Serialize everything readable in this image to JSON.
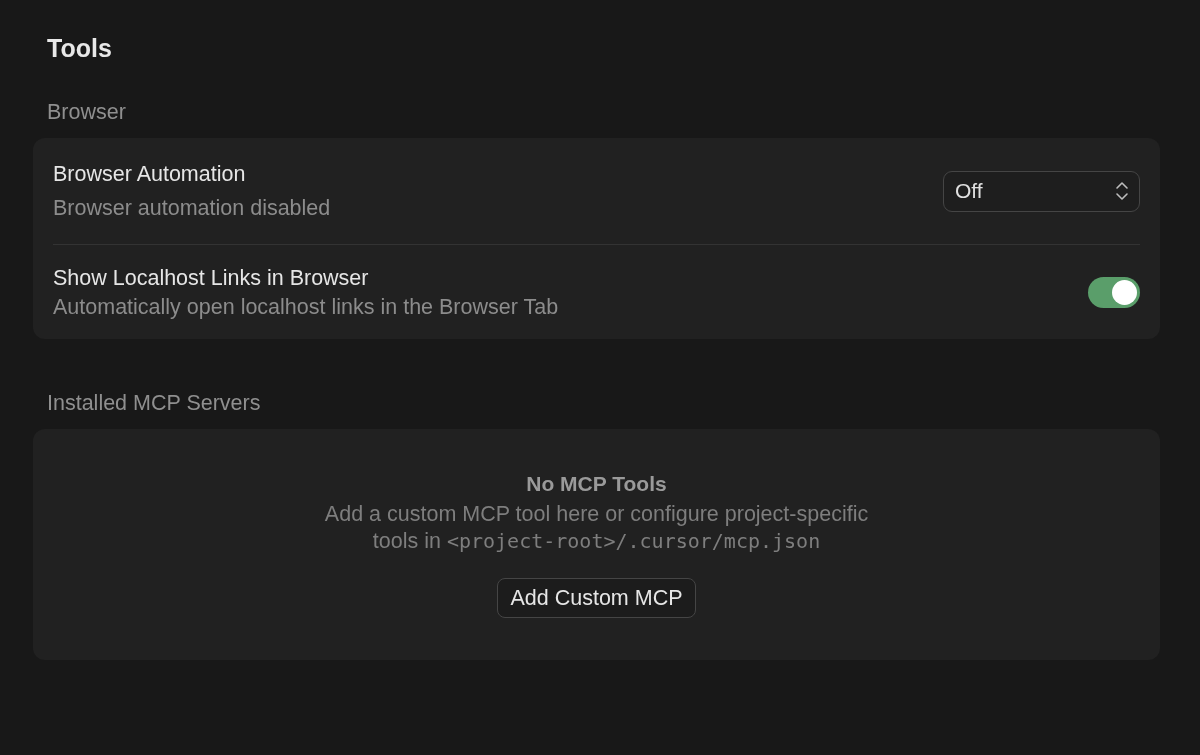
{
  "page": {
    "title": "Tools"
  },
  "sections": [
    {
      "label": "Browser",
      "kind": "settings",
      "settings": [
        {
          "kind": "select",
          "title": "Browser Automation",
          "description": "Browser automation disabled",
          "value": "Off"
        },
        {
          "kind": "toggle",
          "title": "Show Localhost Links in Browser",
          "description": "Automatically open localhost links in the Browser Tab",
          "on": true
        }
      ]
    },
    {
      "label": "Installed MCP Servers",
      "kind": "empty",
      "empty_state": {
        "title": "No MCP Tools",
        "description": "Add a custom MCP tool here or configure project-specific tools in",
        "path": "<project-root>/.cursor/mcp.json",
        "button": "Add Custom MCP"
      }
    }
  ]
}
